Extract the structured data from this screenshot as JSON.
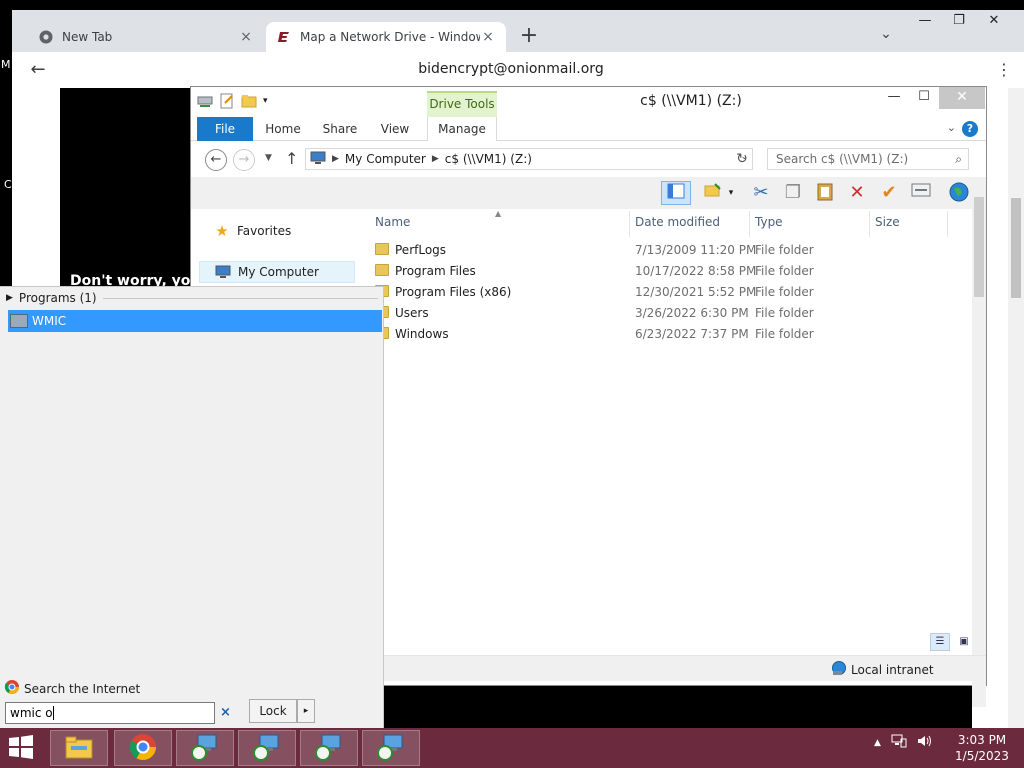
{
  "chrome": {
    "tabs": [
      {
        "title": "New Tab",
        "close": "×"
      },
      {
        "title": "Map a Network Drive - Windows",
        "close": "×"
      }
    ],
    "new_tab": "+",
    "tab_search": "⌄",
    "window_buttons": {
      "minimize": "—",
      "maximize": "❐",
      "close": "✕"
    },
    "back": "←",
    "address": "bidencrypt@onionmail.org",
    "menu": "⋮",
    "page_text": "Don't worry, you",
    "edge_letters": [
      "M",
      "C"
    ]
  },
  "explorer": {
    "contextual_tab": "Drive Tools",
    "title": "c$ (\\\\VM1) (Z:)",
    "window_buttons": {
      "minimize": "—",
      "maximize": "☐",
      "close": "✕"
    },
    "ribbon_tabs": [
      "File",
      "Home",
      "Share",
      "View",
      "Manage"
    ],
    "address": {
      "root": "My Computer",
      "current": "c$ (\\\\VM1) (Z:)"
    },
    "search_placeholder": "Search c$ (\\\\VM1) (Z:)",
    "nav": {
      "favorites": "Favorites",
      "my_computer": "My Computer"
    },
    "columns": [
      "Name",
      "Date modified",
      "Type",
      "Size"
    ],
    "rows": [
      {
        "name": "PerfLogs",
        "date": "7/13/2009 11:20 PM",
        "type": "File folder"
      },
      {
        "name": "Program Files",
        "date": "10/17/2022 8:58 PM",
        "type": "File folder"
      },
      {
        "name": "Program Files (x86)",
        "date": "12/30/2021 5:52 PM",
        "type": "File folder"
      },
      {
        "name": "Users",
        "date": "3/26/2022 6:30 PM",
        "type": "File folder"
      },
      {
        "name": "Windows",
        "date": "6/23/2022 7:37 PM",
        "type": "File folder"
      }
    ],
    "status_zone": "Local intranet"
  },
  "start_panel": {
    "programs_header": "Programs (1)",
    "result": "WMIC",
    "search_internet": "Search the Internet",
    "query": "wmic o",
    "clear": "×",
    "lock": "Lock",
    "lock_arrow": "▸"
  },
  "taskbar": {
    "time": "3:03 PM",
    "date": "1/5/2023",
    "tray_arrow": "▲"
  }
}
